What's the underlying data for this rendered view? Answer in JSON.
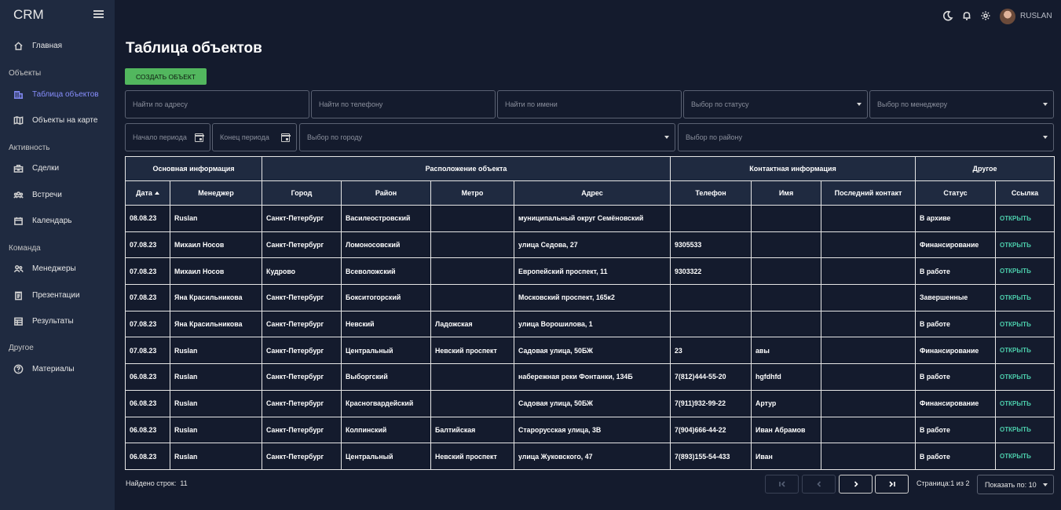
{
  "app": {
    "brand": "CRM",
    "username": "RUSLAN"
  },
  "sidebar": {
    "items": [
      {
        "label": "Главная",
        "icon": "home-icon"
      },
      {
        "section": "Объекты"
      },
      {
        "label": "Таблица объектов",
        "icon": "building-icon",
        "active": true
      },
      {
        "label": "Объекты на карте",
        "icon": "map-icon"
      },
      {
        "section": "Активность"
      },
      {
        "label": "Сделки",
        "icon": "deals-icon"
      },
      {
        "label": "Встречи",
        "icon": "meetings-icon"
      },
      {
        "label": "Календарь",
        "icon": "calendar-icon"
      },
      {
        "section": "Команда"
      },
      {
        "label": "Менеджеры",
        "icon": "managers-icon"
      },
      {
        "label": "Презентации",
        "icon": "presentation-icon"
      },
      {
        "label": "Результаты",
        "icon": "results-icon"
      },
      {
        "section": "Другое"
      },
      {
        "label": "Материалы",
        "icon": "help-icon"
      }
    ]
  },
  "page": {
    "title": "Таблица объектов",
    "create_label": "СОЗДАТЬ ОБЪЕКТ"
  },
  "filters": {
    "address": "Найти по адресу",
    "phone": "Найти по телефону",
    "name": "Найти по имени",
    "status": "Выбор по статусу",
    "manager": "Выбор по менеджеру",
    "period_start": "Начало периода",
    "period_end": "Конец периода",
    "city": "Выбор по городу",
    "district": "Выбор по району"
  },
  "table": {
    "groups": [
      "Основная информация",
      "Расположение объекта",
      "Контактная информация",
      "Другое"
    ],
    "columns": [
      "Дата",
      "Менеджер",
      "Город",
      "Район",
      "Метро",
      "Адрес",
      "Телефон",
      "Имя",
      "Последний контакт",
      "Статус",
      "Ссылка"
    ],
    "rows": [
      [
        "08.08.23",
        "Ruslan",
        "Санкт-Петербург",
        "Василеостровский",
        "",
        "муниципальный округ Семёновский",
        "",
        "",
        "",
        "В архиве",
        "ОТКРЫТЬ"
      ],
      [
        "07.08.23",
        "Михаил Носов",
        "Санкт-Петербург",
        "Ломоносовский",
        "",
        "улица Седова, 27",
        "9305533",
        "",
        "",
        "Финансирование",
        "ОТКРЫТЬ"
      ],
      [
        "07.08.23",
        "Михаил Носов",
        "Кудрово",
        "Всеволожский",
        "",
        "Европейский проспект, 11",
        "9303322",
        "",
        "",
        "В работе",
        "ОТКРЫТЬ"
      ],
      [
        "07.08.23",
        "Яна Красильникова",
        "Санкт-Петербург",
        "Бокситогорский",
        "",
        "Московский проспект, 165к2",
        "",
        "",
        "",
        "Завершенные",
        "ОТКРЫТЬ"
      ],
      [
        "07.08.23",
        "Яна Красильникова",
        "Санкт-Петербург",
        "Невский",
        "Ладожская",
        "улица Ворошилова, 1",
        "",
        "",
        "",
        "В работе",
        "ОТКРЫТЬ"
      ],
      [
        "07.08.23",
        "Ruslan",
        "Санкт-Петербург",
        "Центральный",
        "Невский проспект",
        "Садовая улица, 50БЖ",
        "23",
        "авы",
        "",
        "Финансирование",
        "ОТКРЫТЬ"
      ],
      [
        "06.08.23",
        "Ruslan",
        "Санкт-Петербург",
        "Выборгский",
        "",
        "набережная реки Фонтанки, 134Б",
        "7(812)444-55-20",
        "hgfdhfd",
        "",
        "В работе",
        "ОТКРЫТЬ"
      ],
      [
        "06.08.23",
        "Ruslan",
        "Санкт-Петербург",
        "Красногвардейский",
        "",
        "Садовая улица, 50БЖ",
        "7(911)932-99-22",
        "Артур",
        "",
        "Финансирование",
        "ОТКРЫТЬ"
      ],
      [
        "06.08.23",
        "Ruslan",
        "Санкт-Петербург",
        "Колпинский",
        "Балтийская",
        "Старорусская улица, 3В",
        "7(904)666-44-22",
        "Иван Абрамов",
        "",
        "В работе",
        "ОТКРЫТЬ"
      ],
      [
        "06.08.23",
        "Ruslan",
        "Санкт-Петербург",
        "Центральный",
        "Невский проспект",
        "улица Жуковского, 47",
        "7(893)155-54-433",
        "Иван",
        "",
        "В работе",
        "ОТКРЫТЬ"
      ]
    ]
  },
  "footer": {
    "found_label": "Найдено строк:",
    "found_count": "11",
    "page_info": "Страница:1 из 2",
    "per_page": "Показать по: 10"
  },
  "colors": {
    "background": "#141b2d",
    "sidebar": "#1f2a40",
    "accent": "#868dfb",
    "link": "#4cceac",
    "create_button": "#52b75e"
  }
}
